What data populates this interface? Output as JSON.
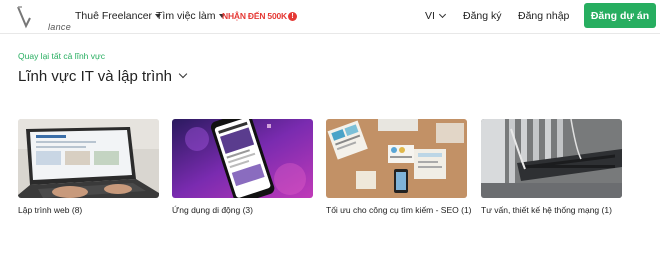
{
  "header": {
    "logo_text": "lance",
    "nav": [
      {
        "label": "Thuê Freelancer"
      },
      {
        "label": "Tìm việc làm"
      }
    ],
    "promo": {
      "label": "NHẬN ĐẾN 500K",
      "badge": "!"
    },
    "language": "VI",
    "register": "Đăng ký",
    "login": "Đăng nhập",
    "cta": "Đăng dự án",
    "colors": {
      "accent": "#27ae60",
      "promo": "#e53935"
    }
  },
  "main": {
    "back_link": "Quay lại tất cả lĩnh vực",
    "title": "Lĩnh vực IT và lập trình",
    "categories": [
      {
        "label": "Lập trình web (8)",
        "thumb": "laptop-photo"
      },
      {
        "label": "Ứng dụng di động (3)",
        "thumb": "smartphone-photo"
      },
      {
        "label": "Tối ưu cho công cụ tìm kiếm - SEO (1)",
        "thumb": "desk-workspace-photo"
      },
      {
        "label": "Tư vấn, thiết kế hệ thống mạng (1)",
        "thumb": "network-cables-photo"
      }
    ]
  }
}
